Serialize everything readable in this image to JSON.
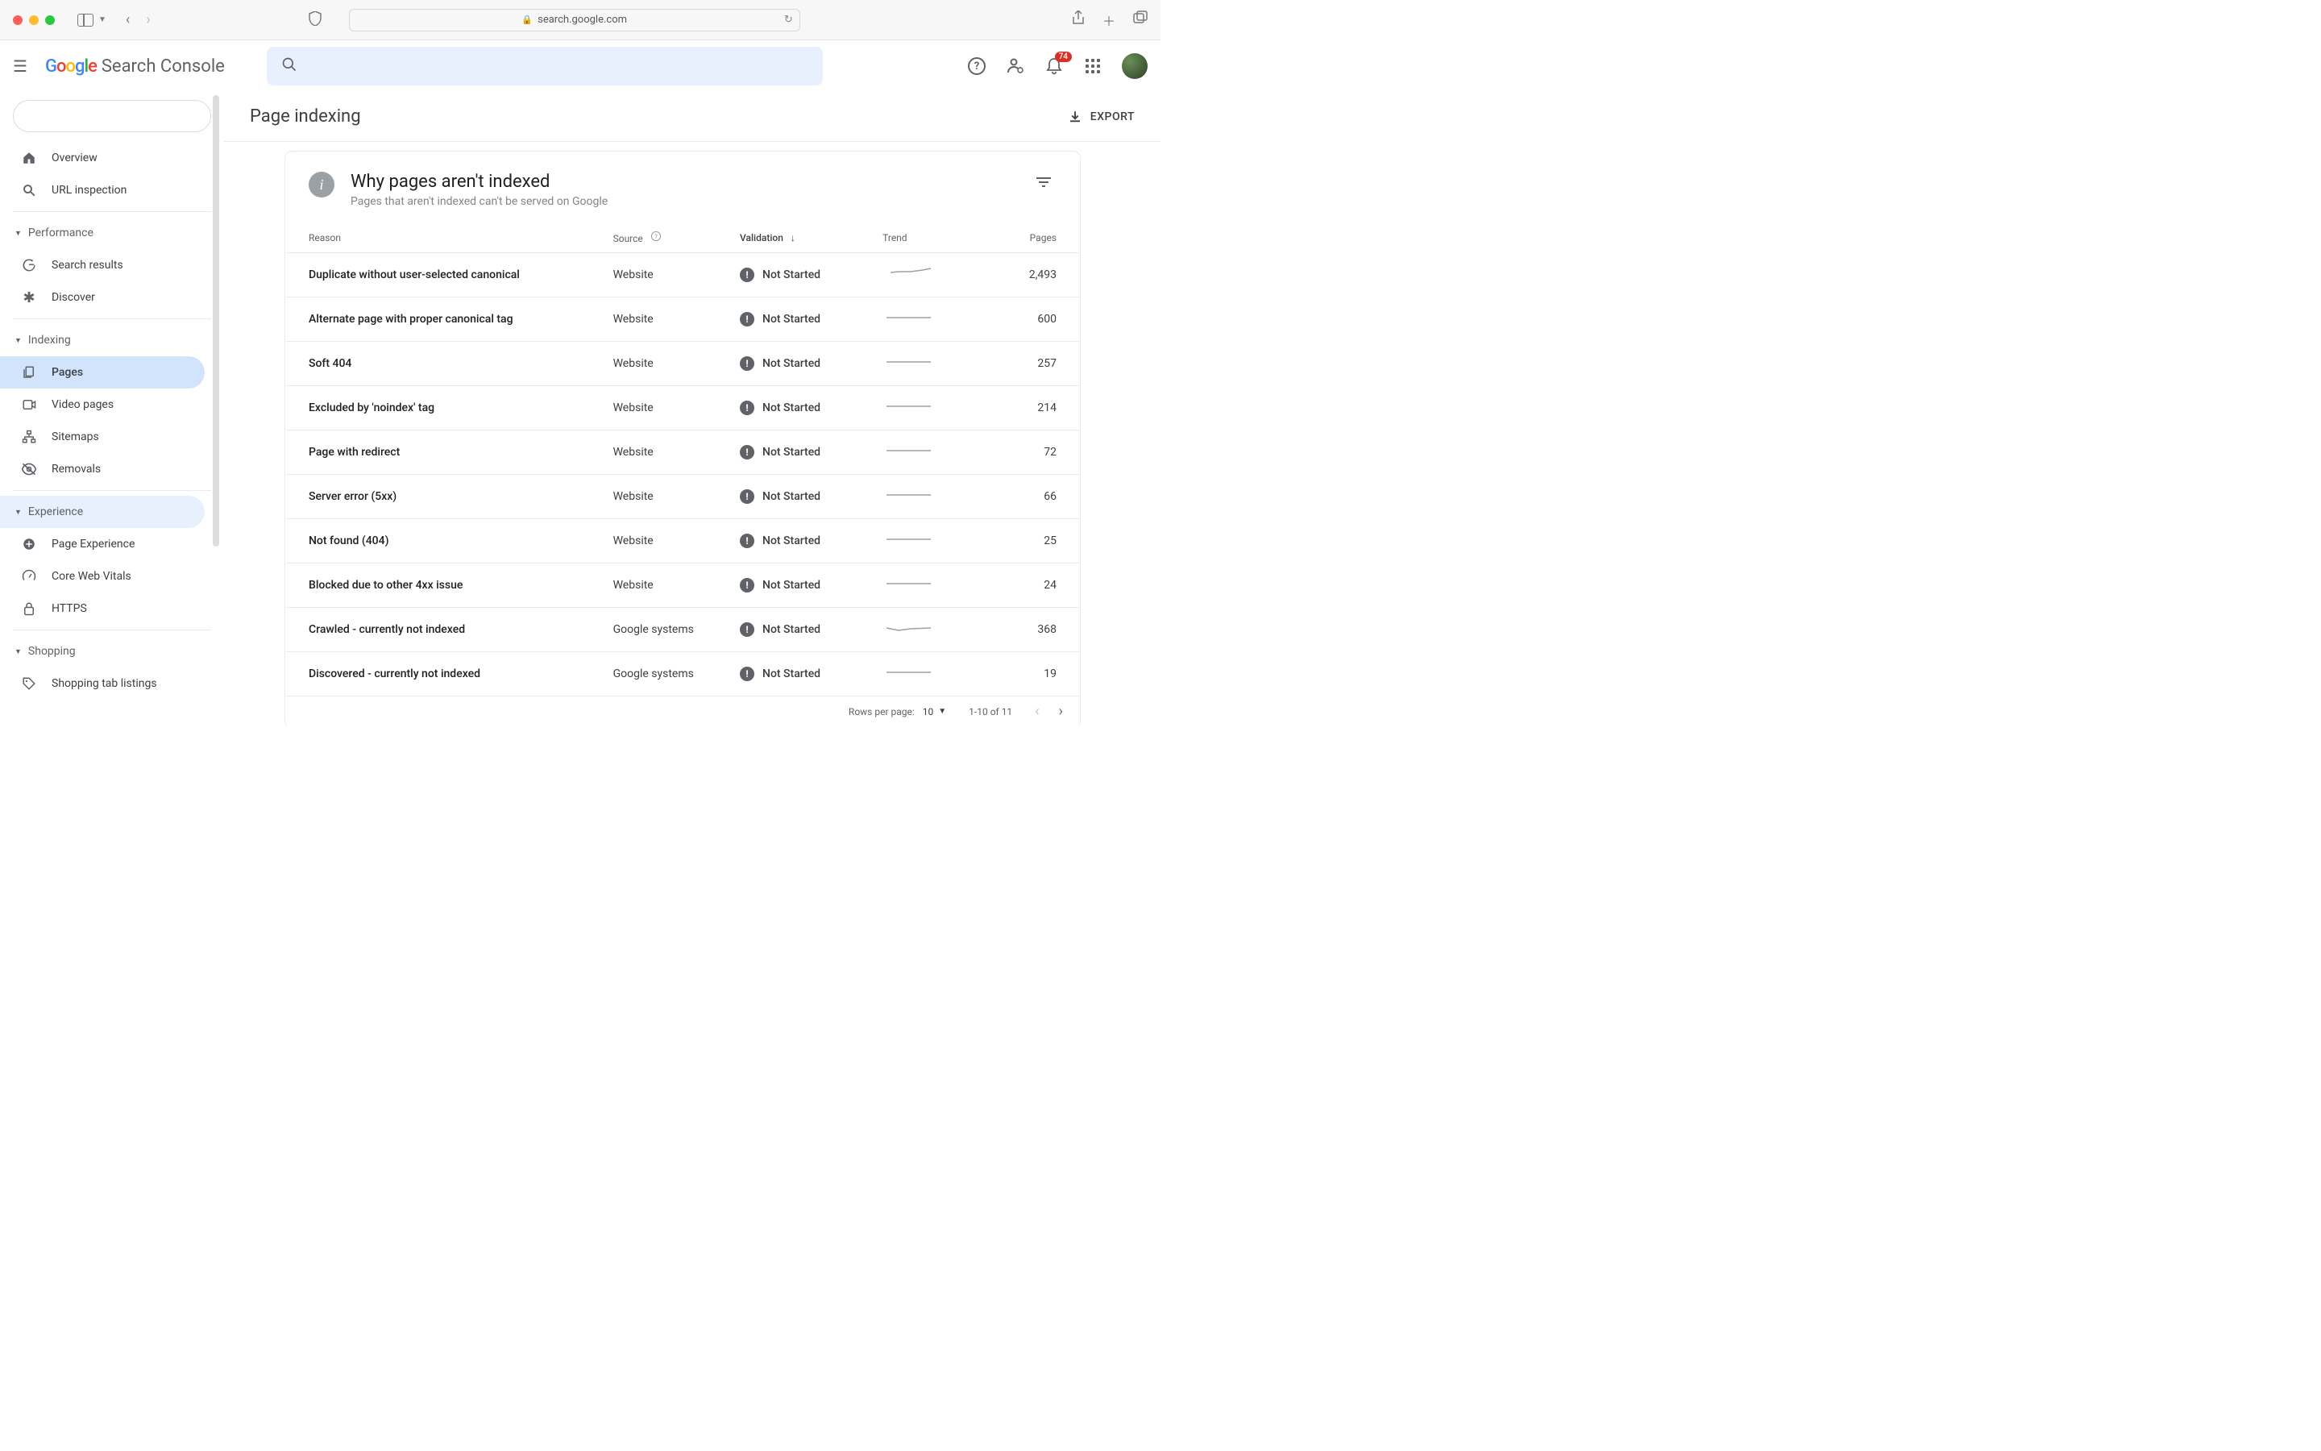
{
  "browser": {
    "url_host": "search.google.com"
  },
  "header": {
    "logo_text": "Search Console",
    "notification_count": "74"
  },
  "sidebar": {
    "items": [
      {
        "label": "Overview"
      },
      {
        "label": "URL inspection"
      }
    ],
    "sections": [
      {
        "title": "Performance",
        "items": [
          {
            "label": "Search results"
          },
          {
            "label": "Discover"
          }
        ]
      },
      {
        "title": "Indexing",
        "items": [
          {
            "label": "Pages",
            "active": true
          },
          {
            "label": "Video pages"
          },
          {
            "label": "Sitemaps"
          },
          {
            "label": "Removals"
          }
        ]
      },
      {
        "title": "Experience",
        "highlighted": true,
        "items": [
          {
            "label": "Page Experience"
          },
          {
            "label": "Core Web Vitals"
          },
          {
            "label": "HTTPS"
          }
        ]
      },
      {
        "title": "Shopping",
        "items": [
          {
            "label": "Shopping tab listings"
          }
        ]
      }
    ]
  },
  "page": {
    "title": "Page indexing",
    "export_label": "EXPORT"
  },
  "card": {
    "title": "Why pages aren't indexed",
    "subtitle": "Pages that aren't indexed can't be served on Google",
    "columns": {
      "reason": "Reason",
      "source": "Source",
      "validation": "Validation",
      "trend": "Trend",
      "pages": "Pages"
    },
    "validation_label": "Not Started",
    "rows": [
      {
        "reason": "Duplicate without user-selected canonical",
        "source": "Website",
        "pages": "2,493",
        "trend": "10,9 20,8 35,8 50,6 60,4"
      },
      {
        "reason": "Alternate page with proper canonical tag",
        "source": "Website",
        "pages": "600",
        "trend": "5,10 60,10"
      },
      {
        "reason": "Soft 404",
        "source": "Website",
        "pages": "257",
        "trend": "5,10 60,10"
      },
      {
        "reason": "Excluded by 'noindex' tag",
        "source": "Website",
        "pages": "214",
        "trend": "5,10 60,10"
      },
      {
        "reason": "Page with redirect",
        "source": "Website",
        "pages": "72",
        "trend": "5,10 60,10"
      },
      {
        "reason": "Server error (5xx)",
        "source": "Website",
        "pages": "66",
        "trend": "5,10 60,10"
      },
      {
        "reason": "Not found (404)",
        "source": "Website",
        "pages": "25",
        "trend": "5,10 60,10"
      },
      {
        "reason": "Blocked due to other 4xx issue",
        "source": "Website",
        "pages": "24",
        "trend": "5,10 60,10"
      },
      {
        "reason": "Crawled - currently not indexed",
        "source": "Google systems",
        "pages": "368",
        "trend": "5,10 20,13 35,11 60,10"
      },
      {
        "reason": "Discovered - currently not indexed",
        "source": "Google systems",
        "pages": "19",
        "trend": "5,10 60,10"
      }
    ],
    "footer": {
      "rows_per_page_label": "Rows per page:",
      "rows_per_page_value": "10",
      "range": "1-10 of 11"
    }
  }
}
